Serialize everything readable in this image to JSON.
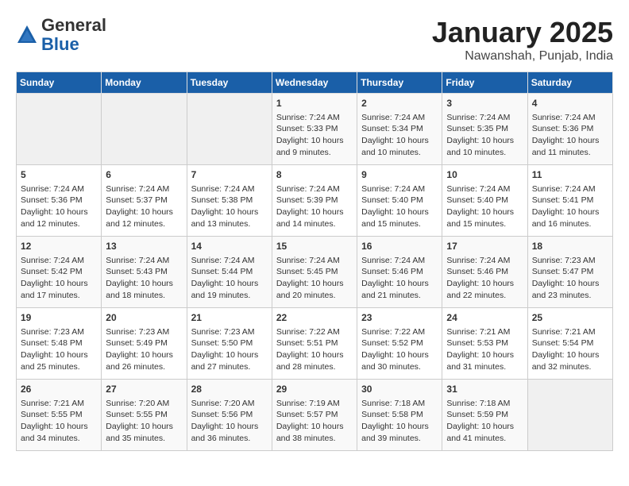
{
  "header": {
    "logo_line1": "General",
    "logo_line2": "Blue",
    "title": "January 2025",
    "subtitle": "Nawanshah, Punjab, India"
  },
  "days_of_week": [
    "Sunday",
    "Monday",
    "Tuesday",
    "Wednesday",
    "Thursday",
    "Friday",
    "Saturday"
  ],
  "weeks": [
    [
      {
        "day": "",
        "info": ""
      },
      {
        "day": "",
        "info": ""
      },
      {
        "day": "",
        "info": ""
      },
      {
        "day": "1",
        "info": "Sunrise: 7:24 AM\nSunset: 5:33 PM\nDaylight: 10 hours\nand 9 minutes."
      },
      {
        "day": "2",
        "info": "Sunrise: 7:24 AM\nSunset: 5:34 PM\nDaylight: 10 hours\nand 10 minutes."
      },
      {
        "day": "3",
        "info": "Sunrise: 7:24 AM\nSunset: 5:35 PM\nDaylight: 10 hours\nand 10 minutes."
      },
      {
        "day": "4",
        "info": "Sunrise: 7:24 AM\nSunset: 5:36 PM\nDaylight: 10 hours\nand 11 minutes."
      }
    ],
    [
      {
        "day": "5",
        "info": "Sunrise: 7:24 AM\nSunset: 5:36 PM\nDaylight: 10 hours\nand 12 minutes."
      },
      {
        "day": "6",
        "info": "Sunrise: 7:24 AM\nSunset: 5:37 PM\nDaylight: 10 hours\nand 12 minutes."
      },
      {
        "day": "7",
        "info": "Sunrise: 7:24 AM\nSunset: 5:38 PM\nDaylight: 10 hours\nand 13 minutes."
      },
      {
        "day": "8",
        "info": "Sunrise: 7:24 AM\nSunset: 5:39 PM\nDaylight: 10 hours\nand 14 minutes."
      },
      {
        "day": "9",
        "info": "Sunrise: 7:24 AM\nSunset: 5:40 PM\nDaylight: 10 hours\nand 15 minutes."
      },
      {
        "day": "10",
        "info": "Sunrise: 7:24 AM\nSunset: 5:40 PM\nDaylight: 10 hours\nand 15 minutes."
      },
      {
        "day": "11",
        "info": "Sunrise: 7:24 AM\nSunset: 5:41 PM\nDaylight: 10 hours\nand 16 minutes."
      }
    ],
    [
      {
        "day": "12",
        "info": "Sunrise: 7:24 AM\nSunset: 5:42 PM\nDaylight: 10 hours\nand 17 minutes."
      },
      {
        "day": "13",
        "info": "Sunrise: 7:24 AM\nSunset: 5:43 PM\nDaylight: 10 hours\nand 18 minutes."
      },
      {
        "day": "14",
        "info": "Sunrise: 7:24 AM\nSunset: 5:44 PM\nDaylight: 10 hours\nand 19 minutes."
      },
      {
        "day": "15",
        "info": "Sunrise: 7:24 AM\nSunset: 5:45 PM\nDaylight: 10 hours\nand 20 minutes."
      },
      {
        "day": "16",
        "info": "Sunrise: 7:24 AM\nSunset: 5:46 PM\nDaylight: 10 hours\nand 21 minutes."
      },
      {
        "day": "17",
        "info": "Sunrise: 7:24 AM\nSunset: 5:46 PM\nDaylight: 10 hours\nand 22 minutes."
      },
      {
        "day": "18",
        "info": "Sunrise: 7:23 AM\nSunset: 5:47 PM\nDaylight: 10 hours\nand 23 minutes."
      }
    ],
    [
      {
        "day": "19",
        "info": "Sunrise: 7:23 AM\nSunset: 5:48 PM\nDaylight: 10 hours\nand 25 minutes."
      },
      {
        "day": "20",
        "info": "Sunrise: 7:23 AM\nSunset: 5:49 PM\nDaylight: 10 hours\nand 26 minutes."
      },
      {
        "day": "21",
        "info": "Sunrise: 7:23 AM\nSunset: 5:50 PM\nDaylight: 10 hours\nand 27 minutes."
      },
      {
        "day": "22",
        "info": "Sunrise: 7:22 AM\nSunset: 5:51 PM\nDaylight: 10 hours\nand 28 minutes."
      },
      {
        "day": "23",
        "info": "Sunrise: 7:22 AM\nSunset: 5:52 PM\nDaylight: 10 hours\nand 30 minutes."
      },
      {
        "day": "24",
        "info": "Sunrise: 7:21 AM\nSunset: 5:53 PM\nDaylight: 10 hours\nand 31 minutes."
      },
      {
        "day": "25",
        "info": "Sunrise: 7:21 AM\nSunset: 5:54 PM\nDaylight: 10 hours\nand 32 minutes."
      }
    ],
    [
      {
        "day": "26",
        "info": "Sunrise: 7:21 AM\nSunset: 5:55 PM\nDaylight: 10 hours\nand 34 minutes."
      },
      {
        "day": "27",
        "info": "Sunrise: 7:20 AM\nSunset: 5:55 PM\nDaylight: 10 hours\nand 35 minutes."
      },
      {
        "day": "28",
        "info": "Sunrise: 7:20 AM\nSunset: 5:56 PM\nDaylight: 10 hours\nand 36 minutes."
      },
      {
        "day": "29",
        "info": "Sunrise: 7:19 AM\nSunset: 5:57 PM\nDaylight: 10 hours\nand 38 minutes."
      },
      {
        "day": "30",
        "info": "Sunrise: 7:18 AM\nSunset: 5:58 PM\nDaylight: 10 hours\nand 39 minutes."
      },
      {
        "day": "31",
        "info": "Sunrise: 7:18 AM\nSunset: 5:59 PM\nDaylight: 10 hours\nand 41 minutes."
      },
      {
        "day": "",
        "info": ""
      }
    ]
  ]
}
